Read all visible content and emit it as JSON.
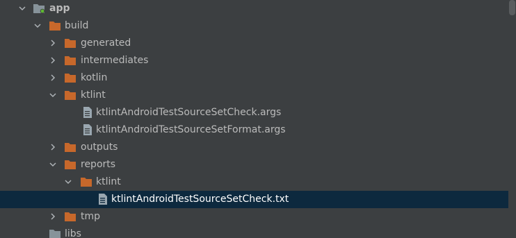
{
  "colors": {
    "background": "#3c3f41",
    "selection": "#0d293e",
    "folder": "#c7682b",
    "module_folder": "#87939a",
    "text": "#bbbbbb"
  },
  "tree": {
    "items": [
      {
        "label": "app",
        "icon": "module-folder-icon",
        "arrow": "expanded"
      },
      {
        "label": "build",
        "icon": "folder-icon",
        "arrow": "expanded"
      },
      {
        "label": "generated",
        "icon": "folder-icon",
        "arrow": "collapsed"
      },
      {
        "label": "intermediates",
        "icon": "folder-icon",
        "arrow": "collapsed"
      },
      {
        "label": "kotlin",
        "icon": "folder-icon",
        "arrow": "collapsed"
      },
      {
        "label": "ktlint",
        "icon": "folder-icon",
        "arrow": "expanded"
      },
      {
        "label": "ktlintAndroidTestSourceSetCheck.args",
        "icon": "text-file-icon",
        "arrow": "none"
      },
      {
        "label": "ktlintAndroidTestSourceSetFormat.args",
        "icon": "text-file-icon",
        "arrow": "none"
      },
      {
        "label": "outputs",
        "icon": "folder-icon",
        "arrow": "collapsed"
      },
      {
        "label": "reports",
        "icon": "folder-icon",
        "arrow": "expanded"
      },
      {
        "label": "ktlint",
        "icon": "folder-icon",
        "arrow": "expanded"
      },
      {
        "label": "ktlintAndroidTestSourceSetCheck.txt",
        "icon": "text-file-icon",
        "arrow": "none",
        "selected": true
      },
      {
        "label": "tmp",
        "icon": "folder-icon",
        "arrow": "collapsed"
      },
      {
        "label": "libs",
        "icon": "plain-folder-icon",
        "arrow": "none"
      }
    ]
  }
}
